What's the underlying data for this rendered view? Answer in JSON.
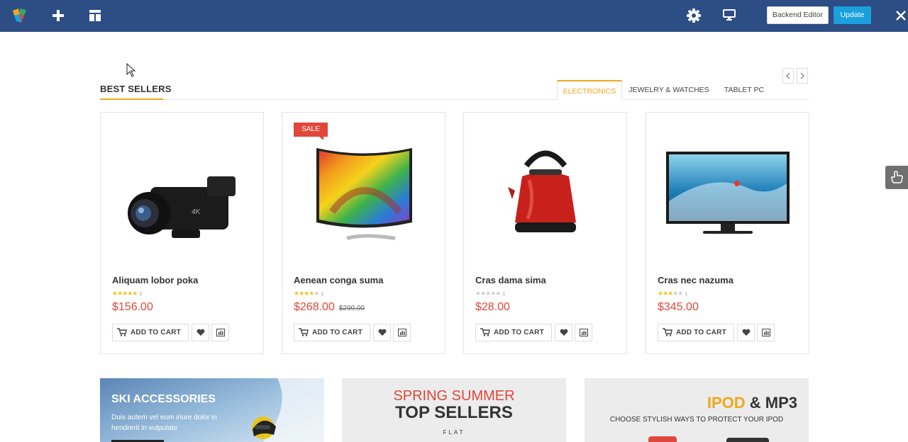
{
  "toolbar": {
    "backend_editor_label": "Backend Editor",
    "update_label": "Update"
  },
  "section": {
    "title": "BEST SELLERS",
    "tabs": [
      {
        "label": "ELECTRONICS",
        "active": true
      },
      {
        "label": "JEWELRY & WATCHES",
        "active": false
      },
      {
        "label": "TABLET PC",
        "active": false
      }
    ]
  },
  "products": [
    {
      "name": "Aliquam lobor poka",
      "rating": 5,
      "review_count": "1",
      "price": "$156.00",
      "old_price": "",
      "sale": false,
      "image": "camcorder"
    },
    {
      "name": "Aenean conga suma",
      "rating": 4,
      "review_count": "1",
      "price": "$268.00",
      "old_price": "$290.00",
      "sale": true,
      "sale_label": "SALE",
      "image": "curved-tv"
    },
    {
      "name": "Cras dama sima",
      "rating": 0,
      "review_count": "1",
      "price": "$28.00",
      "old_price": "",
      "sale": false,
      "image": "electric-kettle"
    },
    {
      "name": "Cras nec nazuma",
      "rating": 3,
      "review_count": "1",
      "price": "$345.00",
      "old_price": "",
      "sale": false,
      "image": "flat-tv"
    }
  ],
  "add_to_cart_label": "ADD TO CART",
  "banners": {
    "ski": {
      "title": "SKI ACCESSORIES",
      "text": "Duis autem vel eum iriure dolor in hendrerit in vulputate"
    },
    "spring": {
      "line1": "SPRING SUMMER",
      "line2": "TOP SELLERS",
      "flat": "FLAT"
    },
    "ipod": {
      "title_accent": "IPOD",
      "title_rest": "& MP3",
      "subtitle": "CHOOSE STYLISH WAYS TO PROTECT YOUR IPOD"
    }
  },
  "colors": {
    "toolbar_bg": "#2d4d85",
    "accent_orange": "#f0a71c",
    "price_red": "#e0473a",
    "update_blue": "#1aa0dd"
  }
}
